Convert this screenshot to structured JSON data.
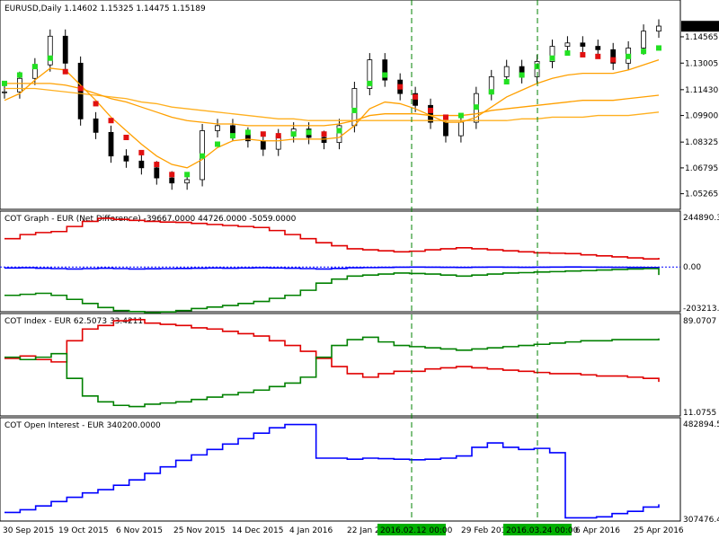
{
  "colors": {
    "background": "#ffffff",
    "pane_bg": "#ececf7",
    "bull_candle": "#ffffff",
    "bear_candle": "#000000",
    "candle_wick": "#000000",
    "trend_up": "#22e022",
    "trend_down": "#e01010",
    "ma_orange": "#ffa000",
    "ma_yellow": "#ffb020",
    "vline_green": "#008000",
    "series_red": "#e00000",
    "series_green": "#008000",
    "series_blue": "#0000ff",
    "zero_line": "#0000ff",
    "axis_label_bg": "#000000",
    "green_tag_bg": "#00b000",
    "grid_text": "#000000"
  },
  "chart_data": [
    {
      "type": "line",
      "pane": "price",
      "title": "EURUSD,Daily  1.14602 1.15325 1.14475 1.15189",
      "symbol": "EURUSD",
      "timeframe": "Daily",
      "ohlc": {
        "open": "1.14602",
        "high": "1.15325",
        "low": "1.14475",
        "close": "1.15189"
      },
      "current_price_tag": "1.15189",
      "y_ticks": [
        "1.14565",
        "1.13005",
        "1.11430",
        "1.09900",
        "1.08325",
        "1.06795",
        "1.05265"
      ],
      "ylim": [
        1.045,
        1.16
      ],
      "series": [
        {
          "name": "close",
          "values": [
            1.113,
            1.121,
            1.129,
            1.146,
            1.13,
            1.097,
            1.089,
            1.075,
            1.072,
            1.068,
            1.062,
            1.059,
            1.061,
            1.09,
            1.093,
            1.088,
            1.084,
            1.079,
            1.087,
            1.091,
            1.086,
            1.083,
            1.093,
            1.115,
            1.132,
            1.12,
            1.112,
            1.105,
            1.095,
            1.087,
            1.095,
            1.112,
            1.122,
            1.128,
            1.122,
            1.131,
            1.14,
            1.142,
            1.14,
            1.138,
            1.13,
            1.139,
            1.149,
            1.152
          ]
        },
        {
          "name": "trend",
          "values": [
            1.118,
            1.123,
            1.128,
            1.133,
            1.125,
            1.115,
            1.106,
            1.096,
            1.086,
            1.077,
            1.07,
            1.064,
            1.064,
            1.075,
            1.082,
            1.087,
            1.089,
            1.088,
            1.087,
            1.088,
            1.089,
            1.088,
            1.09,
            1.102,
            1.118,
            1.123,
            1.116,
            1.11,
            1.102,
            1.098,
            1.099,
            1.104,
            1.113,
            1.119,
            1.123,
            1.128,
            1.133,
            1.136,
            1.135,
            1.134,
            1.132,
            1.134,
            1.137,
            1.139
          ]
        },
        {
          "name": "ma_fast",
          "values": [
            1.108,
            1.112,
            1.12,
            1.127,
            1.126,
            1.117,
            1.108,
            1.098,
            1.09,
            1.082,
            1.075,
            1.07,
            1.068,
            1.073,
            1.08,
            1.084,
            1.085,
            1.084,
            1.084,
            1.085,
            1.085,
            1.085,
            1.086,
            1.093,
            1.103,
            1.107,
            1.106,
            1.103,
            1.099,
            1.095,
            1.095,
            1.098,
            1.104,
            1.11,
            1.114,
            1.118,
            1.121,
            1.123,
            1.124,
            1.124,
            1.124,
            1.126,
            1.129,
            1.132
          ]
        },
        {
          "name": "ma_slow",
          "values": [
            1.118,
            1.118,
            1.118,
            1.118,
            1.117,
            1.115,
            1.112,
            1.109,
            1.107,
            1.104,
            1.101,
            1.098,
            1.096,
            1.095,
            1.094,
            1.094,
            1.093,
            1.093,
            1.093,
            1.093,
            1.093,
            1.093,
            1.094,
            1.096,
            1.099,
            1.1,
            1.1,
            1.1,
            1.099,
            1.099,
            1.099,
            1.1,
            1.102,
            1.103,
            1.104,
            1.105,
            1.106,
            1.107,
            1.108,
            1.108,
            1.108,
            1.109,
            1.11,
            1.111
          ]
        },
        {
          "name": "ma_slowest",
          "values": [
            1.115,
            1.115,
            1.115,
            1.114,
            1.113,
            1.112,
            1.111,
            1.11,
            1.109,
            1.107,
            1.106,
            1.104,
            1.103,
            1.102,
            1.101,
            1.1,
            1.099,
            1.098,
            1.097,
            1.097,
            1.096,
            1.096,
            1.096,
            1.096,
            1.096,
            1.096,
            1.096,
            1.096,
            1.096,
            1.096,
            1.096,
            1.096,
            1.096,
            1.096,
            1.097,
            1.097,
            1.098,
            1.098,
            1.098,
            1.099,
            1.099,
            1.099,
            1.1,
            1.101
          ]
        }
      ]
    },
    {
      "type": "line",
      "pane": "cot_graph",
      "title": "COT Graph - EUR (Net Difference) -39667.0000 44726.0000 -5059.0000",
      "y_ticks": [
        "244890.3",
        "0.00",
        "-203213.3"
      ],
      "ylim": [
        -203213.3,
        244890.3
      ],
      "series": [
        {
          "name": "red",
          "color": "#e00000",
          "values": [
            140000,
            160000,
            170000,
            175000,
            200000,
            225000,
            240000,
            235000,
            230000,
            225000,
            222000,
            220000,
            215000,
            210000,
            205000,
            200000,
            195000,
            180000,
            160000,
            140000,
            120000,
            105000,
            90000,
            85000,
            80000,
            75000,
            78000,
            85000,
            90000,
            95000,
            90000,
            85000,
            80000,
            75000,
            70000,
            68000,
            66000,
            60000,
            55000,
            50000,
            45000,
            40000,
            45000
          ]
        },
        {
          "name": "blue",
          "color": "#0000ff",
          "values": [
            -5000,
            -4000,
            -6000,
            -8000,
            -10000,
            -8000,
            -6000,
            -8000,
            -10000,
            -9000,
            -8000,
            -7000,
            -6000,
            -5000,
            -6000,
            -5000,
            -4000,
            -5000,
            -6000,
            -8000,
            -10000,
            -7000,
            -4000,
            -3000,
            -2000,
            -1000,
            -500,
            -1000,
            -1500,
            -2000,
            -1000,
            -500,
            -1000,
            -1500,
            -1000,
            -500,
            0,
            -500,
            -1000,
            -1500,
            -2000,
            -2500,
            -5059
          ]
        },
        {
          "name": "green",
          "color": "#008000",
          "values": [
            -140000,
            -135000,
            -130000,
            -140000,
            -160000,
            -180000,
            -200000,
            -215000,
            -220000,
            -225000,
            -222000,
            -215000,
            -205000,
            -198000,
            -190000,
            -180000,
            -170000,
            -155000,
            -140000,
            -115000,
            -80000,
            -60000,
            -45000,
            -40000,
            -35000,
            -30000,
            -32000,
            -35000,
            -40000,
            -45000,
            -40000,
            -35000,
            -30000,
            -28000,
            -25000,
            -23000,
            -20000,
            -18000,
            -15000,
            -12000,
            -10000,
            -8000,
            -39667
          ]
        }
      ]
    },
    {
      "type": "line",
      "pane": "cot_index",
      "title": "COT Index - EUR 62.5073 33.4211",
      "y_ticks": [
        "89.0707",
        "11.0755"
      ],
      "ylim": [
        11.0755,
        89.0707
      ],
      "series": [
        {
          "name": "red",
          "color": "#e00000",
          "values": [
            57,
            59,
            56,
            54,
            72,
            82,
            85,
            89,
            90,
            87,
            86,
            85,
            83,
            82,
            80,
            78,
            76,
            72,
            68,
            63,
            57,
            50,
            44,
            41,
            44,
            46,
            46,
            48,
            49,
            50,
            49,
            48,
            47,
            46,
            45,
            44,
            44,
            43,
            42,
            42,
            41,
            40,
            37
          ]
        },
        {
          "name": "green",
          "color": "#008000",
          "values": [
            58,
            56,
            58,
            61,
            40,
            25,
            20,
            17,
            16,
            18,
            19,
            20,
            22,
            24,
            26,
            28,
            30,
            33,
            36,
            41,
            58,
            68,
            73,
            75,
            71,
            68,
            67,
            66,
            65,
            64,
            65,
            66,
            67,
            68,
            69,
            70,
            71,
            72,
            72,
            73,
            73,
            73,
            74
          ]
        }
      ]
    },
    {
      "type": "line",
      "pane": "cot_open_interest",
      "title": "COT Open Interest - EUR  340200.0000",
      "y_ticks": [
        "482894.5",
        "307476.4"
      ],
      "ylim": [
        307476.4,
        482894.5
      ],
      "series": [
        {
          "name": "blue",
          "color": "#0000ff",
          "values": [
            320000,
            325000,
            332000,
            340000,
            348000,
            356000,
            362000,
            370000,
            380000,
            392000,
            404000,
            416000,
            426000,
            436000,
            446000,
            456000,
            466000,
            476000,
            482000,
            482000,
            420000,
            420000,
            418000,
            420000,
            419000,
            418000,
            417000,
            418000,
            420000,
            424000,
            440000,
            448000,
            440000,
            436000,
            438000,
            430000,
            310000,
            310000,
            312000,
            318000,
            322000,
            330000,
            335000
          ]
        }
      ]
    }
  ],
  "x_axis": {
    "labels": [
      "30 Sep 2015",
      "19 Oct 2015",
      "6 Nov 2015",
      "25 Nov 2015",
      "14 Dec 2015",
      "4 Jan 2016",
      "22 Jan 2",
      "29 Feb 2016",
      "6 Apr 2016",
      "25 Apr 2016"
    ],
    "highlight_labels": [
      "2016.02.12 00:00",
      "2016.03.24 00:00"
    ]
  }
}
